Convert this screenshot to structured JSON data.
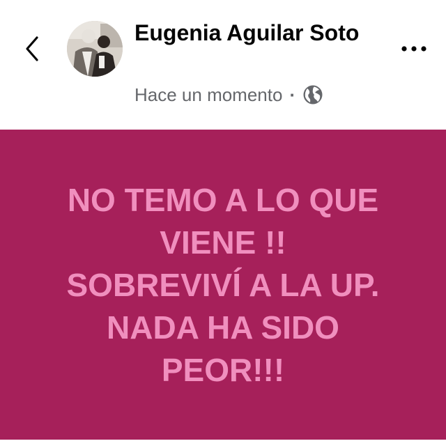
{
  "header": {
    "back_icon": "chevron-left-icon",
    "author_name": "Eugenia Aguilar Soto",
    "timestamp": "Hace un momento",
    "separator": "·",
    "privacy_icon": "globe-icon",
    "more_icon": "more-horizontal-icon"
  },
  "post": {
    "background_color": "#a6205a",
    "text_color": "#f08fbe",
    "lines": [
      "NO TEMO A LO QUE",
      "VIENE !!",
      "SOBREVIVÍ A LA UP.",
      "NADA HA SIDO",
      "PEOR!!!"
    ]
  }
}
